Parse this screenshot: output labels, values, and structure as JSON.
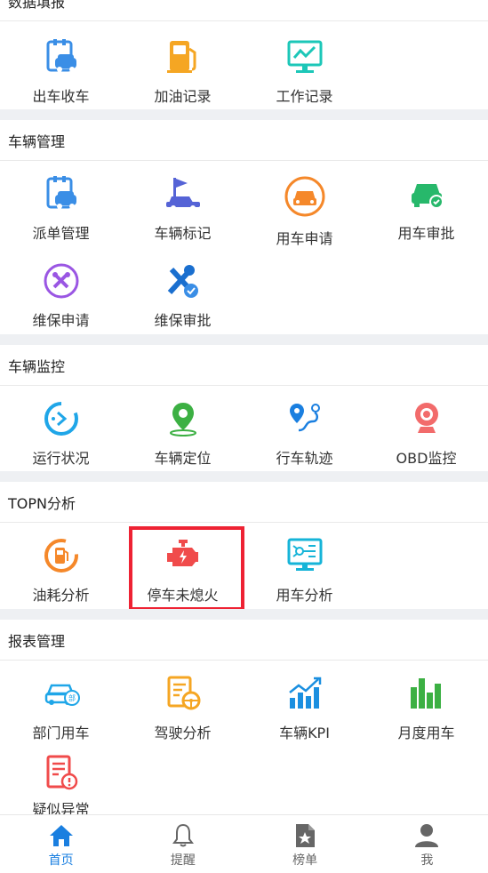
{
  "sections": {
    "data_entry": {
      "title": "数据填报",
      "items": [
        "出车收车",
        "加油记录",
        "工作记录"
      ]
    },
    "vehicle_mgmt": {
      "title": "车辆管理",
      "items": [
        "派单管理",
        "车辆标记",
        "用车申请",
        "用车审批",
        "维保申请",
        "维保审批"
      ]
    },
    "vehicle_monitor": {
      "title": "车辆监控",
      "items": [
        "运行状况",
        "车辆定位",
        "行车轨迹",
        "OBD监控"
      ]
    },
    "topn": {
      "title": "TOPN分析",
      "items": [
        "油耗分析",
        "停车未熄火",
        "用车分析"
      ]
    },
    "reports": {
      "title": "报表管理",
      "items": [
        "部门用车",
        "驾驶分析",
        "车辆KPI",
        "月度用车",
        "疑似异常"
      ]
    }
  },
  "tabbar": [
    "首页",
    "提醒",
    "榜单",
    "我"
  ],
  "colors": {
    "accent": "#1a7fe0",
    "highlight_box": "#ee2233",
    "orange": "#f5a623",
    "teal": "#1cc7b8",
    "purple": "#9a56e3",
    "green": "#27b86b",
    "red": "#f04b4b"
  }
}
